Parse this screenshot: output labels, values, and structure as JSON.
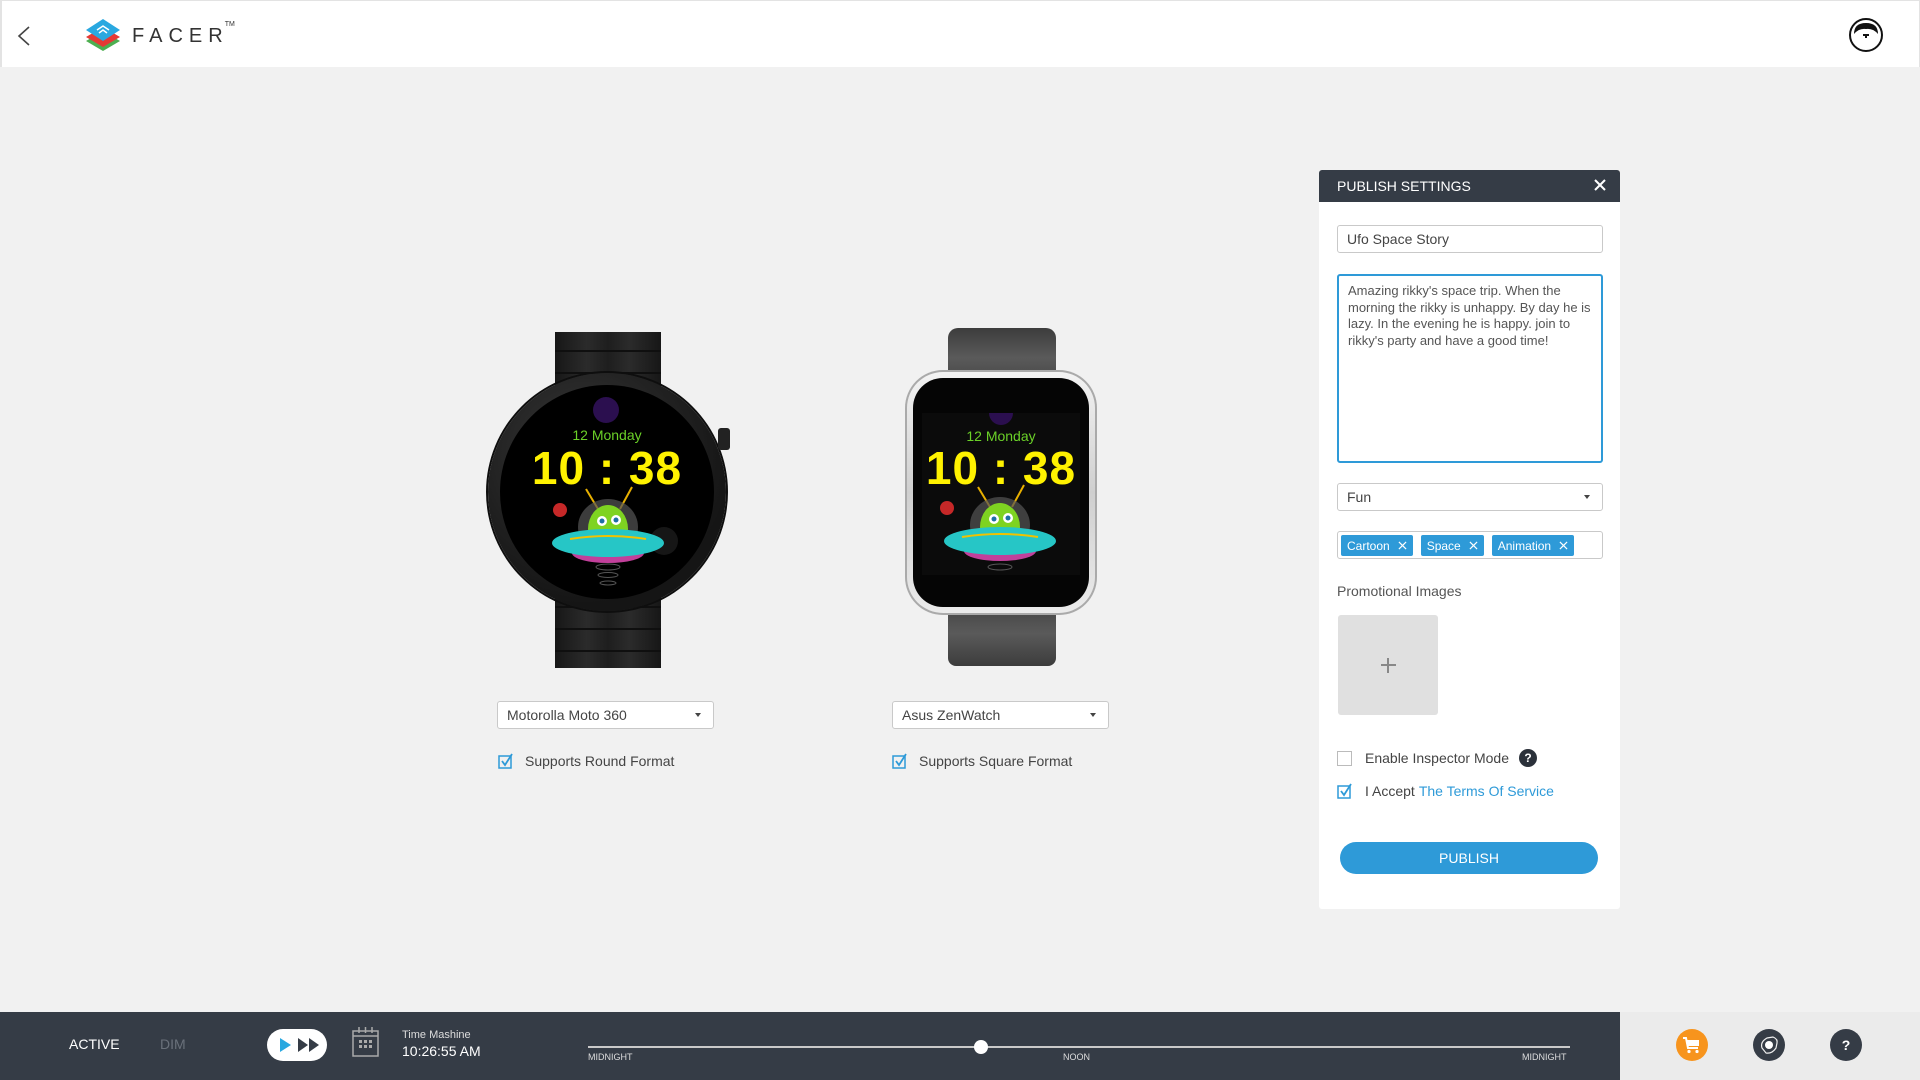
{
  "header": {
    "brand": "FACER",
    "trademark": "TM"
  },
  "watches": [
    {
      "device": "Motorolla Moto 360",
      "support_label": "Supports Round Format",
      "supports": true,
      "shape": "round",
      "face": {
        "date": "12 Monday",
        "time": "10 : 38"
      }
    },
    {
      "device": "Asus ZenWatch",
      "support_label": "Supports Square Format",
      "supports": true,
      "shape": "square",
      "face": {
        "date": "12 Monday",
        "time": "10 : 38"
      }
    }
  ],
  "publish": {
    "title": "PUBLISH SETTINGS",
    "name_value": "Ufo Space Story",
    "description": "Amazing rikky's space trip. When the morning the rikky is unhappy. By day he is lazy. In the evening he is happy. join to rikky's party and have a good time!",
    "category": "Fun",
    "tags": [
      "Cartoon",
      "Space",
      "Animation"
    ],
    "promo_label": "Promotional Images",
    "inspector_label": "Enable Inspector Mode",
    "inspector_checked": false,
    "help_glyph": "?",
    "accept_label": "I Accept",
    "tos_link": "The Terms Of Service",
    "accept_checked": true,
    "publish_button": "PUBLISH"
  },
  "bottom_bar": {
    "active_label": "ACTIVE",
    "dim_label": "DIM",
    "time_machine_label": "Time Mashine",
    "time_value": "10:26:55 AM",
    "slider_labels": [
      "MIDNIGHT",
      "NOON",
      "MIDNIGHT"
    ],
    "slider_fraction": 0.4,
    "help_glyph": "?"
  },
  "colors": {
    "accent": "#2e9ad8",
    "dark": "#353c46",
    "shop": "#f7941d",
    "face_date": "#6bd128",
    "face_time": "#fff200"
  }
}
